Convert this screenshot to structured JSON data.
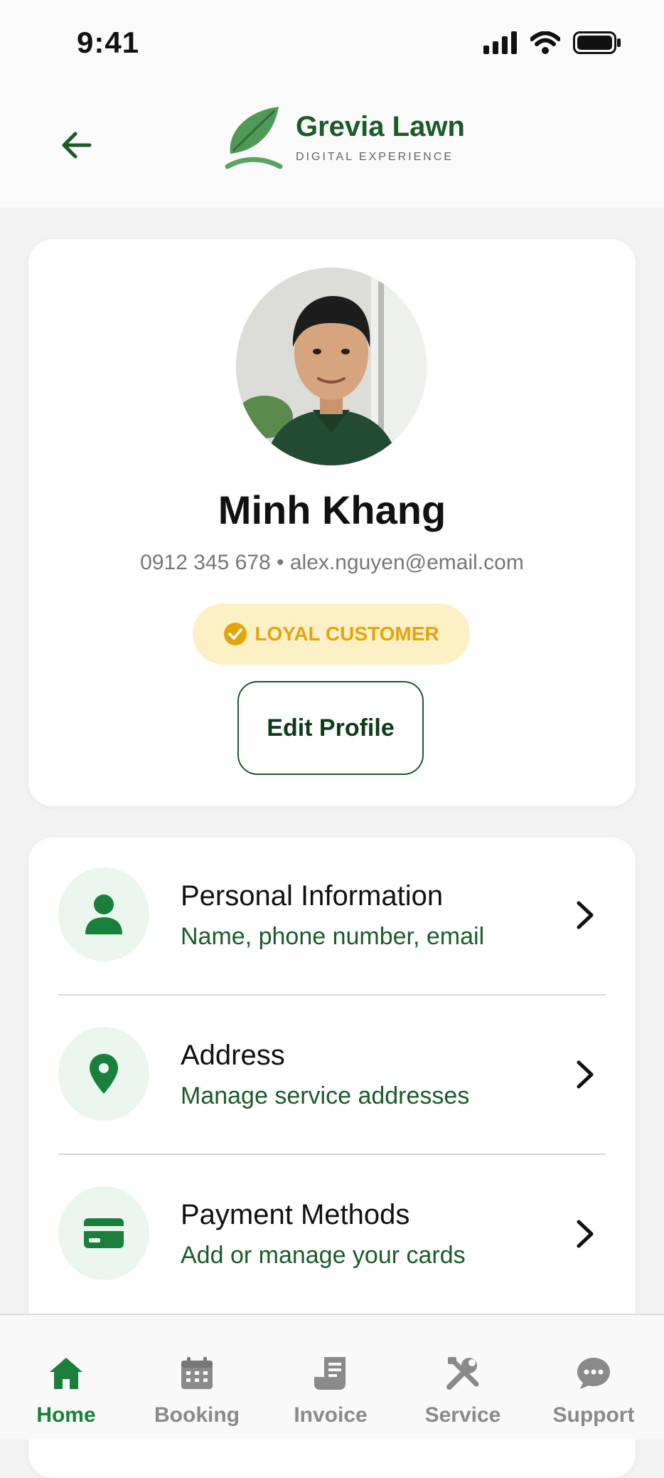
{
  "status_bar": {
    "time": "9:41"
  },
  "header": {
    "brand_name": "Grevia Lawn",
    "brand_tagline": "DIGITAL EXPERIENCE"
  },
  "profile": {
    "name": "Minh Khang",
    "contact": "0912 345 678 • alex.nguyen@email.com",
    "badge": "LOYAL CUSTOMER",
    "edit_label": "Edit Profile"
  },
  "menu": {
    "items": [
      {
        "title": "Personal Information",
        "subtitle": "Name, phone number, email",
        "icon": "person-icon"
      },
      {
        "title": "Address",
        "subtitle": "Manage service addresses",
        "icon": "location-pin-icon"
      },
      {
        "title": "Payment Methods",
        "subtitle": "Add or manage your cards",
        "icon": "credit-card-icon"
      }
    ]
  },
  "nav": {
    "items": [
      {
        "label": "Home",
        "icon": "home-icon",
        "active": true
      },
      {
        "label": "Booking",
        "icon": "calendar-icon",
        "active": false
      },
      {
        "label": "Invoice",
        "icon": "invoice-icon",
        "active": false
      },
      {
        "label": "Service",
        "icon": "tools-icon",
        "active": false
      },
      {
        "label": "Support",
        "icon": "chat-icon",
        "active": false
      }
    ]
  },
  "colors": {
    "brand": "#1c5a2b",
    "accent_green": "#1a7f3a",
    "badge_bg": "#fdf0c4",
    "badge_text": "#e2a60d",
    "icon_circle_bg": "#eaf6ee",
    "inactive": "#8a8a8a"
  }
}
